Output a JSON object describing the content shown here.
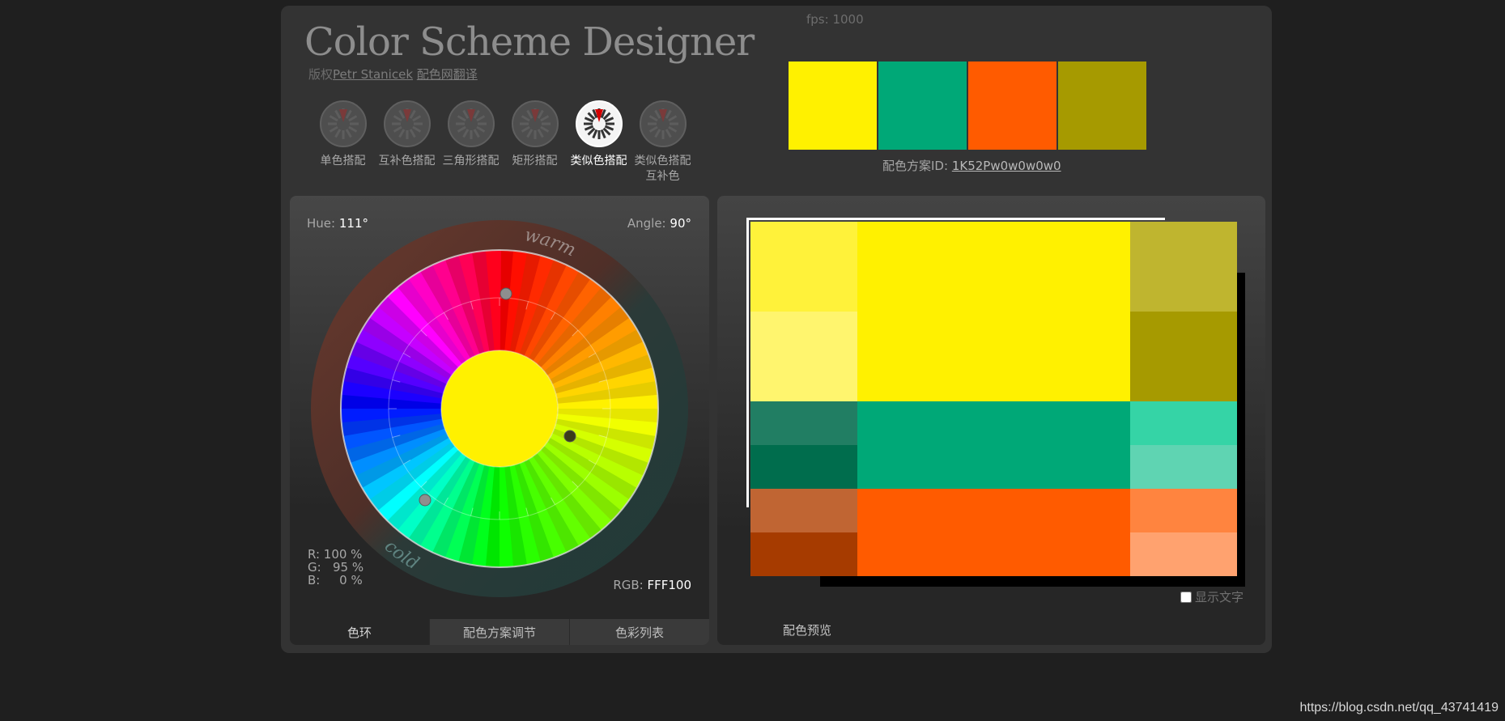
{
  "app": {
    "fps": "fps: 1000",
    "title": "Color Scheme Designer",
    "credit_prefix": "版权",
    "credit_author": "Petr Stanicek",
    "credit_translator": "配色网翻译"
  },
  "modes": [
    {
      "label": "单色搭配",
      "icon": "mono-mode-icon",
      "active": false
    },
    {
      "label": "互补色搭配",
      "icon": "complement-mode-icon",
      "active": false
    },
    {
      "label": "三角形搭配",
      "icon": "triad-mode-icon",
      "active": false
    },
    {
      "label": "矩形搭配",
      "icon": "tetrad-mode-icon",
      "active": false
    },
    {
      "label": "类似色搭配",
      "icon": "analogic-mode-icon",
      "active": true
    },
    {
      "label": "类似色搭配互补色",
      "icon": "analogic-accent-mode-icon",
      "active": false
    }
  ],
  "swatches": [
    "#FFF100",
    "#00A877",
    "#FF5B00",
    "#A69A00"
  ],
  "scheme": {
    "label": "配色方案ID:",
    "id": "1K52Pw0w0w0w0"
  },
  "wheel": {
    "hue_label": "Hue:",
    "hue_value": "111°",
    "angle_label": "Angle:",
    "angle_value": "90°",
    "rgb_values": "R: 100 %\nG:   95 %\nB:     0 %",
    "rgb_label": "RGB:",
    "rgb_hex": "FFF100",
    "warm_label": "warm",
    "cold_label": "cold",
    "center_color": "#FFF100"
  },
  "tabs_left": [
    "色环",
    "配色方案调节",
    "色彩列表"
  ],
  "preview": {
    "show_text_label": "显示文字",
    "tab_label": "配色预览",
    "palette": {
      "primary": [
        "#FFF23A",
        "#FFF56E",
        "#FFF100",
        "#BFB52F",
        "#A69A00"
      ],
      "secondary_a": [
        "#217E63",
        "#006D4D",
        "#00A877",
        "#35D4A6",
        "#5FD4B2"
      ],
      "secondary_b": [
        "#C06533",
        "#A63B00",
        "#FF5B00",
        "#FF843F",
        "#FFA26F"
      ]
    }
  },
  "watermark": "https://blog.csdn.net/qq_43741419"
}
